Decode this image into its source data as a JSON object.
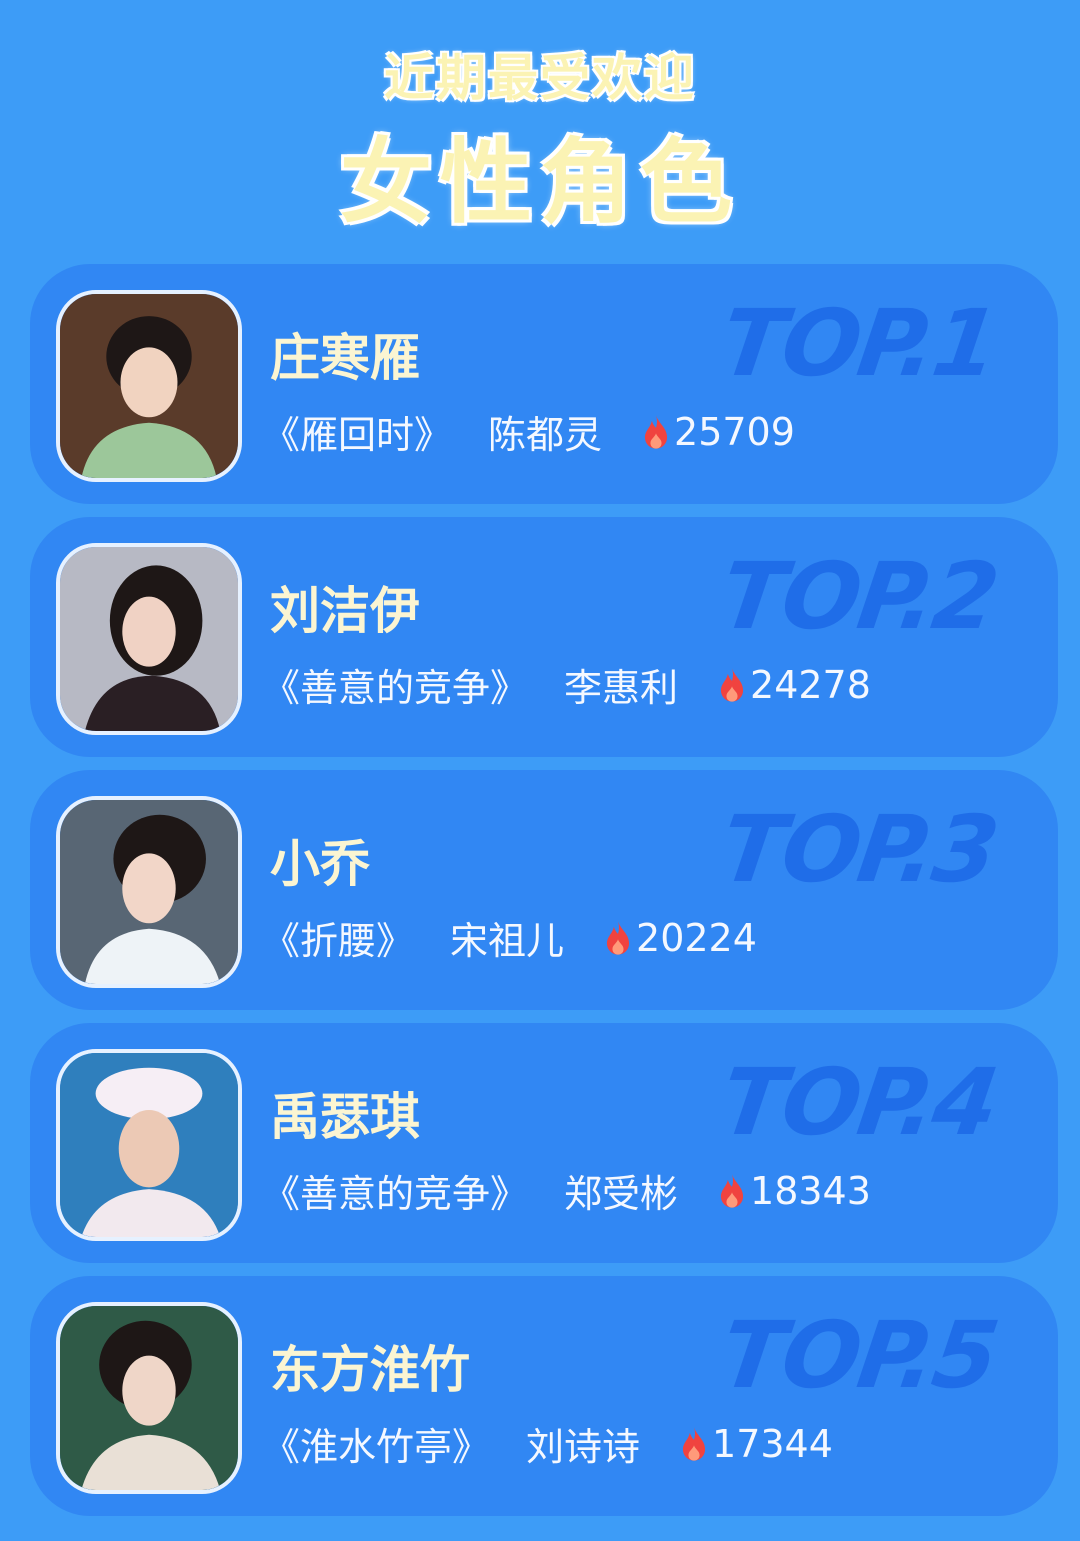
{
  "header": {
    "subtitle": "近期最受欢迎",
    "title": "女性角色"
  },
  "entries": [
    {
      "name": "庄寒雁",
      "show": "《雁回时》",
      "actor": "陈都灵",
      "score": "25709",
      "rank": "TOP.1",
      "avatar_bg": "#5a3b2a",
      "avatar_skin": "#f1d3c0",
      "avatar_cloth": "#9cc79a"
    },
    {
      "name": "刘洁伊",
      "show": "《善意的竞争》",
      "actor": "李惠利",
      "score": "24278",
      "rank": "TOP.2",
      "avatar_bg": "#b7b9c4",
      "avatar_skin": "#f0d2c4",
      "avatar_cloth": "#2a1f24"
    },
    {
      "name": "小乔",
      "show": "《折腰》",
      "actor": "宋祖儿",
      "score": "20224",
      "rank": "TOP.3",
      "avatar_bg": "#586674",
      "avatar_skin": "#f2d6c8",
      "avatar_cloth": "#eef3f7"
    },
    {
      "name": "禹瑟琪",
      "show": "《善意的竞争》",
      "actor": "郑受彬",
      "score": "18343",
      "rank": "TOP.4",
      "avatar_bg": "#2f7fbd",
      "avatar_skin": "#ecc9b5",
      "avatar_cloth": "#f2e9ee"
    },
    {
      "name": "东方淮竹",
      "show": "《淮水竹亭》",
      "actor": "刘诗诗",
      "score": "17344",
      "rank": "TOP.5",
      "avatar_bg": "#2f5a47",
      "avatar_skin": "#efd6c8",
      "avatar_cloth": "#e9e0d6"
    }
  ],
  "colors": {
    "background": "#3d9cf7",
    "card": "#3187f3",
    "rank_text": "#1f6de8",
    "title_text": "#fbf3b4",
    "flame": "#f0433f"
  },
  "icons": {
    "score_icon": "flame-icon"
  }
}
